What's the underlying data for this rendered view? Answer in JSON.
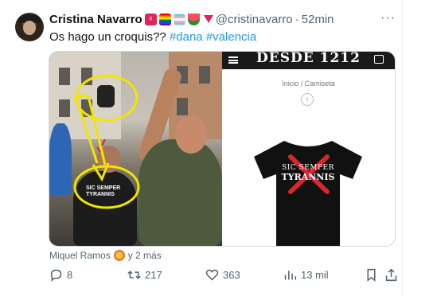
{
  "author": {
    "name": "Cristina Navarro",
    "emoji": [
      "venus",
      "rainbow-flag",
      "transgender-flag",
      "watermelon",
      "red-triangle"
    ],
    "handle": "@cristinavarro",
    "separator": "·",
    "timestamp": "52min"
  },
  "tweet": {
    "text": "Os hago un croquis??",
    "hashtags": [
      "#dana",
      "#valencia"
    ]
  },
  "media": {
    "left_photo": {
      "shirt_text_line1": "SIC SEMPER",
      "shirt_text_line2": "TYRANNIS",
      "annotation_color": "#f2e600"
    },
    "right_photo": {
      "shop_logo": "DESDE 1212",
      "breadcrumb": "Inicio  /  Camiseta",
      "shirt_text_line1": "SIC SEMPER",
      "shirt_text_line2": "TYRANNIS",
      "cross_color": "#d7262d"
    }
  },
  "likes_by": {
    "name": "Miquel Ramos",
    "suffix": "y 2 más"
  },
  "actions": {
    "replies": "8",
    "retweets": "217",
    "likes": "363",
    "views": "13 mil"
  },
  "colors": {
    "link": "#1d9bf0",
    "muted": "#536471"
  }
}
